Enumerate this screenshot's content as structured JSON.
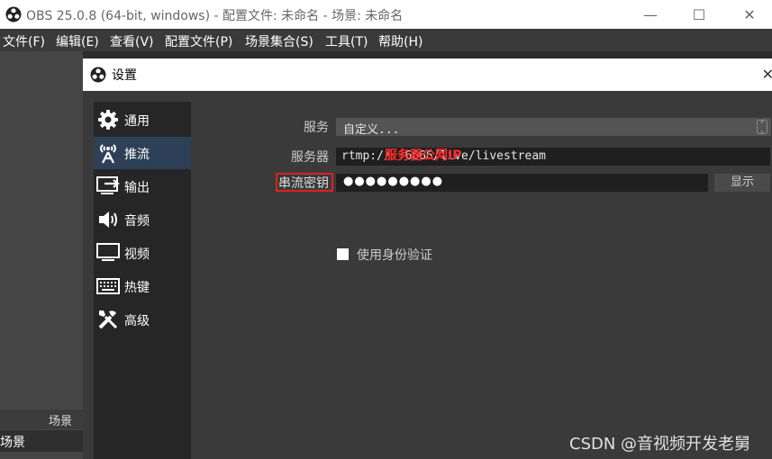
{
  "window": {
    "title": "OBS 25.0.8 (64-bit, windows) - 配置文件: 未命名 - 场景: 未命名",
    "controls": {
      "minimize": "—",
      "maximize": "☐",
      "close": "✕"
    }
  },
  "menubar": {
    "items": [
      "文件(F)",
      "编辑(E)",
      "查看(V)",
      "配置文件(P)",
      "场景集合(S)",
      "工具(T)",
      "帮助(H)"
    ]
  },
  "scenes": {
    "header": "场景",
    "items": [
      "场景"
    ]
  },
  "dialog": {
    "title": "设置",
    "close": "✕"
  },
  "nav": {
    "items": [
      {
        "label": "通用",
        "icon": "gear-icon"
      },
      {
        "label": "推流",
        "icon": "broadcast-antenna-icon",
        "active": true
      },
      {
        "label": "输出",
        "icon": "output-monitor-icon"
      },
      {
        "label": "音频",
        "icon": "speaker-icon"
      },
      {
        "label": "视频",
        "icon": "monitor-icon"
      },
      {
        "label": "热键",
        "icon": "keyboard-icon"
      },
      {
        "label": "高级",
        "icon": "tools-icon"
      }
    ]
  },
  "stream": {
    "service_label": "服务",
    "service_value": "自定义...",
    "server_label": "服务器",
    "server_value": "rtmp://           :6666/live/livestream",
    "server_annotation": "服务器公网IP",
    "key_label": "串流密钥",
    "key_value": "●●●●●●●●●",
    "show_button": "显示",
    "auth_checkbox_label": "使用身份验证",
    "auth_checked": false
  },
  "watermark": "CSDN @音视频开发老舅",
  "colors": {
    "highlight_box": "#e02020",
    "annotation_text": "#ff2a2a",
    "nav_active": "#2e4057"
  }
}
